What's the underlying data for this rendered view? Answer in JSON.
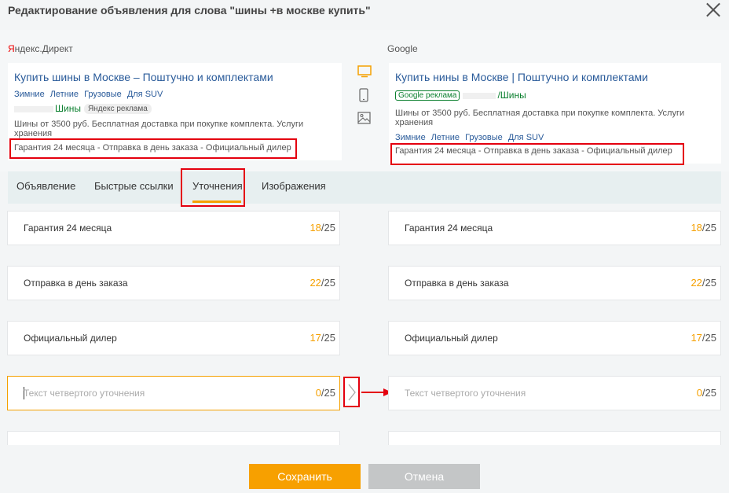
{
  "dialog": {
    "title": "Редактирование объявления для слова \"шины +в москве купить\""
  },
  "yandex": {
    "label_first": "Я",
    "label_rest": "ндекс.Директ",
    "ad_title": "Купить шины в Москве – Поштучно и комплектами",
    "links": [
      "Зимние",
      "Летние",
      "Грузовые",
      "Для SUV"
    ],
    "url_text": "Шины",
    "badge": "Яндекс реклама",
    "description": "Шины от 3500 руб. Бесплатная доставка при покупке комплекта. Услуги хранения",
    "callouts": "Гарантия 24 месяца - Отправка в день заказа - Официальный дилер"
  },
  "google": {
    "label": "Google",
    "ad_title": "Купить нины в Москве | Поштучно и комплектами",
    "badge": "Google реклама",
    "url_text": "/Шины",
    "description": "Шины от 3500 руб. Бесплатная доставка при покупке комплекта. Услуги хранения",
    "links": [
      "Зимние",
      "Летние",
      "Грузовые",
      "Для SUV"
    ],
    "callouts": "Гарантия 24 месяца - Отправка в день заказа - Официальный дилер"
  },
  "device_icons": [
    "desktop-icon",
    "mobile-icon",
    "image-icon"
  ],
  "tabs": [
    "Объявление",
    "Быстрые ссылки",
    "Уточнения",
    "Изображения"
  ],
  "active_tab": "Уточнения",
  "fields": [
    {
      "text": "Гарантия 24 месяца",
      "count": "18",
      "max": "/25"
    },
    {
      "text": "Отправка в день заказа",
      "count": "22",
      "max": "/25"
    },
    {
      "text": "Официальный дилер",
      "count": "17",
      "max": "/25"
    },
    {
      "placeholder": "Текст четвертого уточнения",
      "count": "0",
      "max": "/25"
    }
  ],
  "buttons": {
    "save": "Сохранить",
    "cancel": "Отмена"
  },
  "colors": {
    "accent": "#f7a000",
    "link": "#2a5b9a",
    "highlight": "#e4000f"
  }
}
